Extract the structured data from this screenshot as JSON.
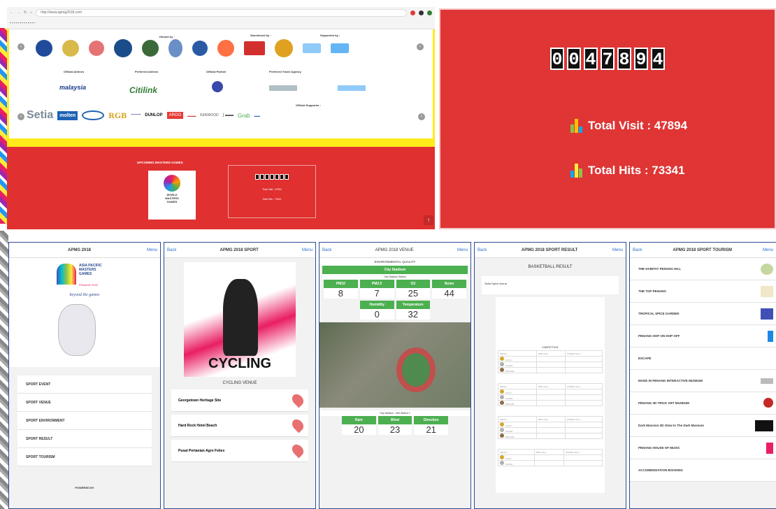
{
  "browser": {
    "url": "http://www.apmg2018.com"
  },
  "sponsor_panel": {
    "hosted_by": "Hosted by :",
    "sanctioned_by": "Sanctioned by :",
    "supported_by": "Supported by :",
    "official_airlines": "Official Airlines",
    "preferred_airlines": "Preferred Airlines",
    "official_partner": "Official Partner",
    "preferred_travel": "Preferred Travel Agency",
    "official_sponsors": "Official Supporter :",
    "sponsor_names": [
      "Setia",
      "molten",
      "RGB",
      "DUNLOP",
      "AROO",
      "KENWOOD",
      "Grab"
    ],
    "airline_names": [
      "malaysia",
      "Citilink"
    ]
  },
  "upcoming": {
    "title": "UPCOMING MASTERS GAMES",
    "logo_text": "WORLD MASTERS GAMES"
  },
  "counter": {
    "digits": [
      "0",
      "0",
      "4",
      "7",
      "8",
      "9",
      "4"
    ],
    "total_visit_label": "Total Visit : 47894",
    "total_hits_label": "Total Hits : 73341",
    "mini_visit": "Total Visit : 47894",
    "mini_hits": "Total Hits : 73341"
  },
  "phone1": {
    "title": "APMG 2018",
    "menu": "Menu",
    "logo_text": "ASIA PACIFIC MASTERS GAMES",
    "logo_sub": "PENANG 2018",
    "tagline": "beyond the games",
    "items": [
      "SPORT EVENT",
      "SPORT VENUE",
      "SPORT ENVIRONMENT",
      "SPORT RESULT",
      "SPORT TOURISM"
    ],
    "powered": "POWERED BY"
  },
  "phone2": {
    "back": "Back",
    "title": "APMG 2018 SPORT",
    "menu": "Menu",
    "banner": "CYCLING",
    "venue_title": "CYCLING VENUE",
    "venues": [
      "Georgetown Heritage Site",
      "Hard Rock Hotel Beach",
      "Pusat Pertanian Agro Feliex"
    ]
  },
  "phone3": {
    "back": "Back",
    "title": "APMG 2018 VENUE",
    "menu": "Menu",
    "subtitle": "ENVIRONMENTAL QUALITY",
    "station": "City Stadium",
    "station_sub": "City Stadium Station",
    "params": [
      {
        "name": "PM10",
        "value": "8"
      },
      {
        "name": "PM2.5",
        "value": "7"
      },
      {
        "name": "O3",
        "value": "25"
      },
      {
        "name": "Noise",
        "value": "44"
      }
    ],
    "params2": [
      {
        "name": "Humidity",
        "value": "0"
      },
      {
        "name": "Temperature",
        "value": "32"
      }
    ],
    "station2": "City Stadium - Met Station 1",
    "params3": [
      {
        "name": "Rain",
        "value": "20"
      },
      {
        "name": "Wind",
        "value": "23"
      },
      {
        "name": "Direction",
        "value": "21"
      }
    ]
  },
  "phone4": {
    "back": "Back",
    "title": "APMG 2018 SPORT RESULT",
    "menu": "Menu",
    "subtitle": "BASKETBALL RESULT",
    "arena": "Setia Spice Arena",
    "competitive": "COMPETITIVE",
    "cols": [
      "MEDAL",
      "MEN (40+)",
      "WOMEN (40+)"
    ],
    "medals": [
      "GOLD",
      "SILVER",
      "BRONZE"
    ]
  },
  "phone5": {
    "back": "Back",
    "title": "APMG 2018 SPORT TOURISM",
    "menu": "Menu",
    "items": [
      "THE HABITAT PENANG HILL",
      "THE TOP PENANG",
      "TROPICAL SPICE GARDEN",
      "PENANG HOP ON HOP OFF",
      "ESCAPE",
      "MADE IN PENANG INTERACTIVE MUSEUM",
      "PENANG 3D TRICK ART MUSEUM",
      "Dark Mansion 3D Glow In The Dark Museum",
      "PENANG HOUSE OF MUSIC",
      "ACCOMMODATION BOOKING"
    ]
  },
  "colors": {
    "red": "#df3535",
    "yellow": "#ffeb1a",
    "green": "#4caf50",
    "blue_link": "#2c6fd0"
  }
}
